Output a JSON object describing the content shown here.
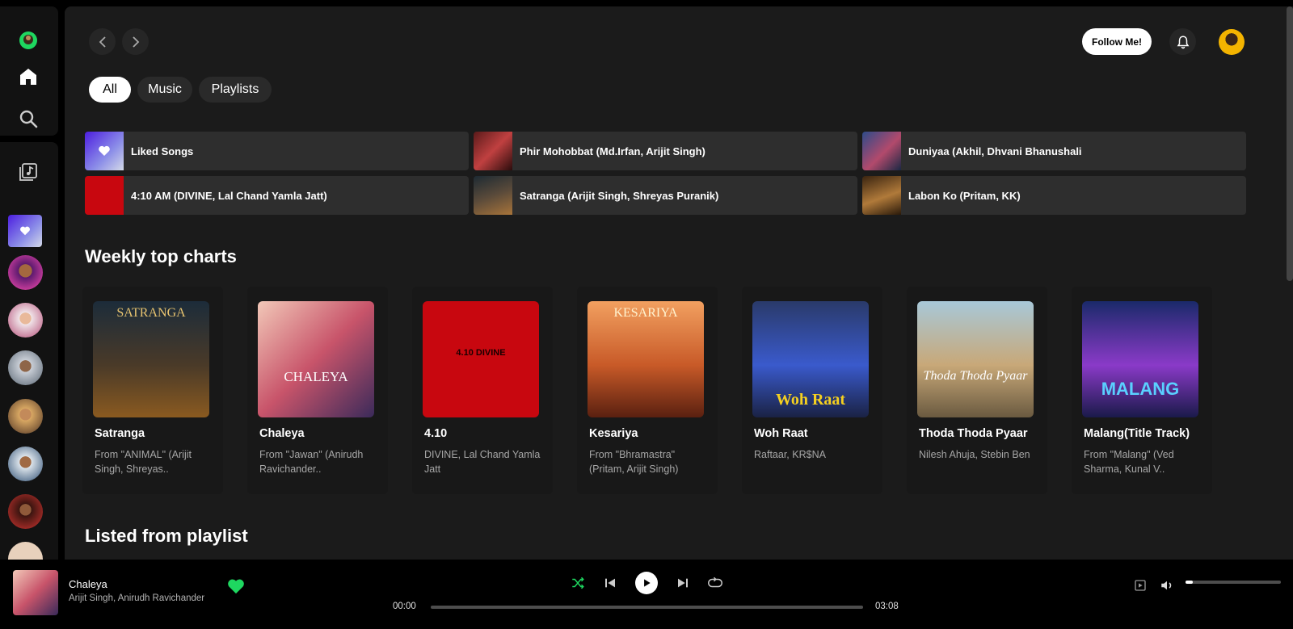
{
  "header": {
    "follow_label": "Follow Me!"
  },
  "filters": [
    "All",
    "Music",
    "Playlists"
  ],
  "quick_picks": [
    {
      "title": "Liked Songs"
    },
    {
      "title": "Phir Mohobbat (Md.Irfan, Arijit Singh)"
    },
    {
      "title": "Duniyaa (Akhil, Dhvani Bhanushali"
    },
    {
      "title": "4:10 AM (DIVINE, Lal Chand Yamla Jatt)"
    },
    {
      "title": "Satranga (Arijit Singh, Shreyas Puranik)"
    },
    {
      "title": "Labon Ko (Pritam, KK)"
    }
  ],
  "weekly": {
    "title": "Weekly top charts",
    "cards": [
      {
        "title": "Satranga",
        "subtitle": "From \"ANIMAL\" (Arijit Singh, Shreyas..",
        "art_text": "SATRANGA"
      },
      {
        "title": "Chaleya",
        "subtitle": "From \"Jawan\" (Anirudh Ravichander..",
        "art_text": "CHALEYA"
      },
      {
        "title": "4.10",
        "subtitle": "DIVINE, Lal Chand Yamla Jatt",
        "art_text": "4.10 DIVINE"
      },
      {
        "title": "Kesariya",
        "subtitle": "From \"Bhramastra\" (Pritam, Arijit Singh)",
        "art_text": "KESARIYA"
      },
      {
        "title": "Woh Raat",
        "subtitle": "Raftaar, KR$NA",
        "art_text": "Woh Raat"
      },
      {
        "title": "Thoda Thoda Pyaar",
        "subtitle": "Nilesh Ahuja, Stebin Ben",
        "art_text": "Thoda Thoda Pyaar"
      },
      {
        "title": "Malang(Title Track)",
        "subtitle": "From \"Malang\" (Ved Sharma, Kunal V..",
        "art_text": "MALANG"
      }
    ]
  },
  "listed": {
    "title": "Listed from playlist"
  },
  "player": {
    "title": "Chaleya",
    "artist": "Arijit Singh, Anirudh Ravichander",
    "current_time": "00:00",
    "duration": "03:08",
    "progress": 0,
    "volume": 0.08,
    "accent": "#1ed760"
  }
}
